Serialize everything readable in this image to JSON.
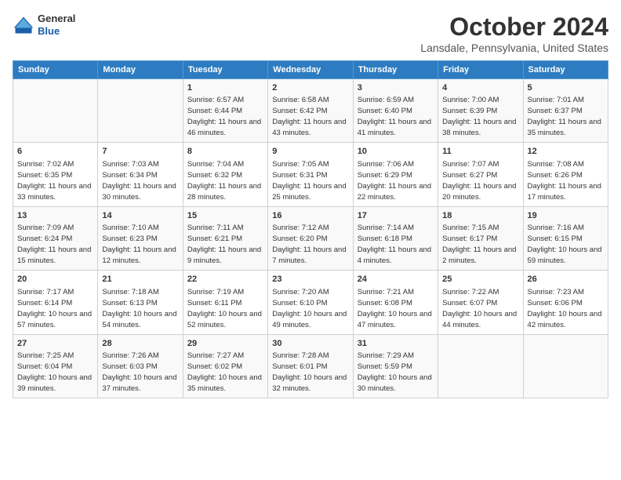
{
  "header": {
    "logo_line1": "General",
    "logo_line2": "Blue",
    "title": "October 2024",
    "subtitle": "Lansdale, Pennsylvania, United States"
  },
  "days_of_week": [
    "Sunday",
    "Monday",
    "Tuesday",
    "Wednesday",
    "Thursday",
    "Friday",
    "Saturday"
  ],
  "weeks": [
    [
      {
        "day": "",
        "info": ""
      },
      {
        "day": "",
        "info": ""
      },
      {
        "day": "1",
        "info": "Sunrise: 6:57 AM\nSunset: 6:44 PM\nDaylight: 11 hours and 46 minutes."
      },
      {
        "day": "2",
        "info": "Sunrise: 6:58 AM\nSunset: 6:42 PM\nDaylight: 11 hours and 43 minutes."
      },
      {
        "day": "3",
        "info": "Sunrise: 6:59 AM\nSunset: 6:40 PM\nDaylight: 11 hours and 41 minutes."
      },
      {
        "day": "4",
        "info": "Sunrise: 7:00 AM\nSunset: 6:39 PM\nDaylight: 11 hours and 38 minutes."
      },
      {
        "day": "5",
        "info": "Sunrise: 7:01 AM\nSunset: 6:37 PM\nDaylight: 11 hours and 35 minutes."
      }
    ],
    [
      {
        "day": "6",
        "info": "Sunrise: 7:02 AM\nSunset: 6:35 PM\nDaylight: 11 hours and 33 minutes."
      },
      {
        "day": "7",
        "info": "Sunrise: 7:03 AM\nSunset: 6:34 PM\nDaylight: 11 hours and 30 minutes."
      },
      {
        "day": "8",
        "info": "Sunrise: 7:04 AM\nSunset: 6:32 PM\nDaylight: 11 hours and 28 minutes."
      },
      {
        "day": "9",
        "info": "Sunrise: 7:05 AM\nSunset: 6:31 PM\nDaylight: 11 hours and 25 minutes."
      },
      {
        "day": "10",
        "info": "Sunrise: 7:06 AM\nSunset: 6:29 PM\nDaylight: 11 hours and 22 minutes."
      },
      {
        "day": "11",
        "info": "Sunrise: 7:07 AM\nSunset: 6:27 PM\nDaylight: 11 hours and 20 minutes."
      },
      {
        "day": "12",
        "info": "Sunrise: 7:08 AM\nSunset: 6:26 PM\nDaylight: 11 hours and 17 minutes."
      }
    ],
    [
      {
        "day": "13",
        "info": "Sunrise: 7:09 AM\nSunset: 6:24 PM\nDaylight: 11 hours and 15 minutes."
      },
      {
        "day": "14",
        "info": "Sunrise: 7:10 AM\nSunset: 6:23 PM\nDaylight: 11 hours and 12 minutes."
      },
      {
        "day": "15",
        "info": "Sunrise: 7:11 AM\nSunset: 6:21 PM\nDaylight: 11 hours and 9 minutes."
      },
      {
        "day": "16",
        "info": "Sunrise: 7:12 AM\nSunset: 6:20 PM\nDaylight: 11 hours and 7 minutes."
      },
      {
        "day": "17",
        "info": "Sunrise: 7:14 AM\nSunset: 6:18 PM\nDaylight: 11 hours and 4 minutes."
      },
      {
        "day": "18",
        "info": "Sunrise: 7:15 AM\nSunset: 6:17 PM\nDaylight: 11 hours and 2 minutes."
      },
      {
        "day": "19",
        "info": "Sunrise: 7:16 AM\nSunset: 6:15 PM\nDaylight: 10 hours and 59 minutes."
      }
    ],
    [
      {
        "day": "20",
        "info": "Sunrise: 7:17 AM\nSunset: 6:14 PM\nDaylight: 10 hours and 57 minutes."
      },
      {
        "day": "21",
        "info": "Sunrise: 7:18 AM\nSunset: 6:13 PM\nDaylight: 10 hours and 54 minutes."
      },
      {
        "day": "22",
        "info": "Sunrise: 7:19 AM\nSunset: 6:11 PM\nDaylight: 10 hours and 52 minutes."
      },
      {
        "day": "23",
        "info": "Sunrise: 7:20 AM\nSunset: 6:10 PM\nDaylight: 10 hours and 49 minutes."
      },
      {
        "day": "24",
        "info": "Sunrise: 7:21 AM\nSunset: 6:08 PM\nDaylight: 10 hours and 47 minutes."
      },
      {
        "day": "25",
        "info": "Sunrise: 7:22 AM\nSunset: 6:07 PM\nDaylight: 10 hours and 44 minutes."
      },
      {
        "day": "26",
        "info": "Sunrise: 7:23 AM\nSunset: 6:06 PM\nDaylight: 10 hours and 42 minutes."
      }
    ],
    [
      {
        "day": "27",
        "info": "Sunrise: 7:25 AM\nSunset: 6:04 PM\nDaylight: 10 hours and 39 minutes."
      },
      {
        "day": "28",
        "info": "Sunrise: 7:26 AM\nSunset: 6:03 PM\nDaylight: 10 hours and 37 minutes."
      },
      {
        "day": "29",
        "info": "Sunrise: 7:27 AM\nSunset: 6:02 PM\nDaylight: 10 hours and 35 minutes."
      },
      {
        "day": "30",
        "info": "Sunrise: 7:28 AM\nSunset: 6:01 PM\nDaylight: 10 hours and 32 minutes."
      },
      {
        "day": "31",
        "info": "Sunrise: 7:29 AM\nSunset: 5:59 PM\nDaylight: 10 hours and 30 minutes."
      },
      {
        "day": "",
        "info": ""
      },
      {
        "day": "",
        "info": ""
      }
    ]
  ]
}
